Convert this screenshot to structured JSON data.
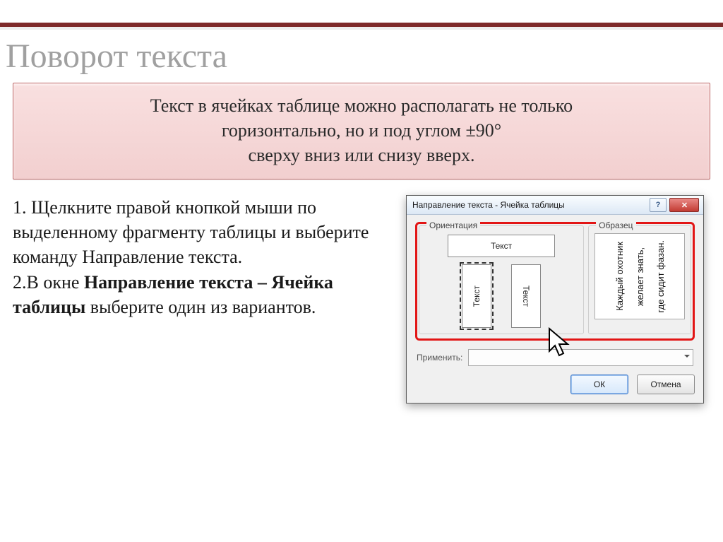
{
  "slide": {
    "title": "Поворот текста",
    "callout_l1": "Текст в ячейках таблице можно располагать не только",
    "callout_l2": "горизонтально, но и под углом ±90°",
    "callout_l3": "сверху вниз или снизу вверх."
  },
  "steps": {
    "s1a": "1. Щелкните правой кнопкой мыши по выделенному фрагменту таблицы и выберите",
    "s1b": "команду Направление текста.",
    "s2a": "2.В окне ",
    "s2b": "Направление текста – Ячейка таблицы",
    "s2c": " выберите один из вариантов."
  },
  "dialog": {
    "title": "Направление текста - Ячейка таблицы",
    "help": "?",
    "close": "✕",
    "group_orientation": "Ориентация",
    "group_sample": "Образец",
    "text_word": "Текст",
    "sample_line1": "Каждый охотник",
    "sample_line2": "желает знать,",
    "sample_line3": "где сидит фазан.",
    "apply_label": "Применить:",
    "ok": "ОК",
    "cancel": "Отмена"
  }
}
